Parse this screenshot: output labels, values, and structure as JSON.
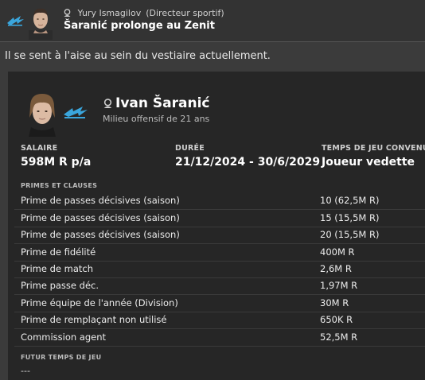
{
  "message": {
    "sender_name": "Yury Ismagilov",
    "sender_role": "(Directeur sportif)",
    "subject": "Šaranić prolonge au Zenit",
    "body": "Il se sent à l'aise au sein du vestiaire actuellement."
  },
  "player": {
    "name": "Ivan Šaranić",
    "description": "Milieu offensif de 21 ans"
  },
  "contract": {
    "salary_label": "SALAIRE",
    "salary_value": "598M R p/a",
    "duration_label": "DURÉE",
    "duration_value": "21/12/2024 - 30/6/2029",
    "playing_time_label": "TEMPS DE JEU CONVENU",
    "playing_time_value": "Joueur vedette"
  },
  "clauses": {
    "title": "PRIMES ET CLAUSES",
    "rows": [
      {
        "name": "Prime de passes décisives (saison)",
        "value": "10 (62,5M R)"
      },
      {
        "name": "Prime de passes décisives (saison)",
        "value": "15 (15,5M R)"
      },
      {
        "name": "Prime de passes décisives (saison)",
        "value": "20 (15,5M R)"
      },
      {
        "name": "Prime de fidélité",
        "value": "400M R"
      },
      {
        "name": "Prime de match",
        "value": "2,6M R"
      },
      {
        "name": "Prime passe déc.",
        "value": "1,97M R"
      },
      {
        "name": "Prime équipe de l'année (Division)",
        "value": "30M R"
      },
      {
        "name": "Prime de remplaçant non utilisé",
        "value": "650K R"
      },
      {
        "name": "Commission agent",
        "value": "52,5M R"
      }
    ]
  },
  "future": {
    "title": "FUTUR TEMPS DE JEU",
    "value": "---"
  },
  "colors": {
    "zenit_blue": "#3aa6dd",
    "background": "#3b3b3b",
    "card": "#262626"
  },
  "icons": [
    "zenit-logo-icon",
    "person-icon",
    "sender-face-icon",
    "player-face-icon"
  ]
}
